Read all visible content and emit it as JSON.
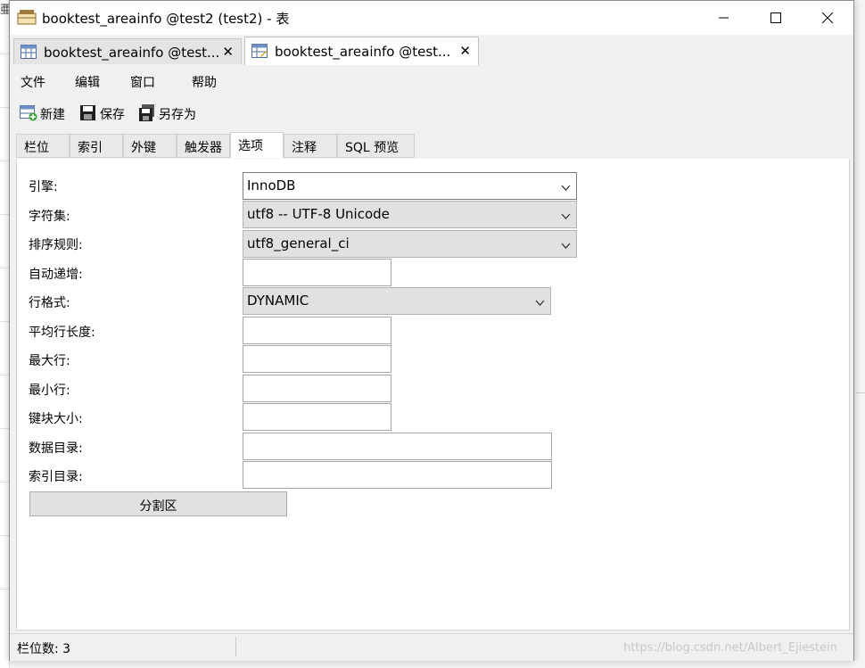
{
  "window": {
    "title": "booktest_areainfo @test2 (test2) - 表"
  },
  "background": {
    "corner_glyph": "亜"
  },
  "doc_tabs": [
    {
      "label": "booktest_areainfo @test...",
      "close": "✕",
      "active": false
    },
    {
      "label": "booktest_areainfo @test...",
      "close": "✕",
      "active": true
    }
  ],
  "menu": {
    "items": [
      "文件",
      "编辑",
      "窗口",
      "帮助"
    ]
  },
  "toolbar": {
    "new_label": "新建",
    "save_label": "保存",
    "save_as_label": "另存为"
  },
  "prop_tabs": {
    "items": [
      "栏位",
      "索引",
      "外键",
      "触发器",
      "选项",
      "注释",
      "SQL 预览"
    ],
    "active": "选项"
  },
  "options": {
    "engine_label": "引擎:",
    "engine_value": "InnoDB",
    "charset_label": "字符集:",
    "charset_value": "utf8 -- UTF-8 Unicode",
    "collation_label": "排序规则:",
    "collation_value": "utf8_general_ci",
    "auto_increment_label": "自动递增:",
    "auto_increment_value": "",
    "row_format_label": "行格式:",
    "row_format_value": "DYNAMIC",
    "avg_row_length_label": "平均行长度:",
    "avg_row_length_value": "",
    "max_rows_label": "最大行:",
    "max_rows_value": "",
    "min_rows_label": "最小行:",
    "min_rows_value": "",
    "key_block_size_label": "键块大小:",
    "key_block_size_value": "",
    "data_directory_label": "数据目录:",
    "data_directory_value": "",
    "index_directory_label": "索引目录:",
    "index_directory_value": "",
    "partition_button": "分割区"
  },
  "status": {
    "text": "栏位数: 3",
    "watermark": "https://blog.csdn.net/Albert_Ejiestein"
  },
  "colors": {
    "window_bg": "#f0f0f0",
    "panel_bg": "#ffffff",
    "combo_bg": "#e1e1e1",
    "border": "#a6a6a6"
  }
}
